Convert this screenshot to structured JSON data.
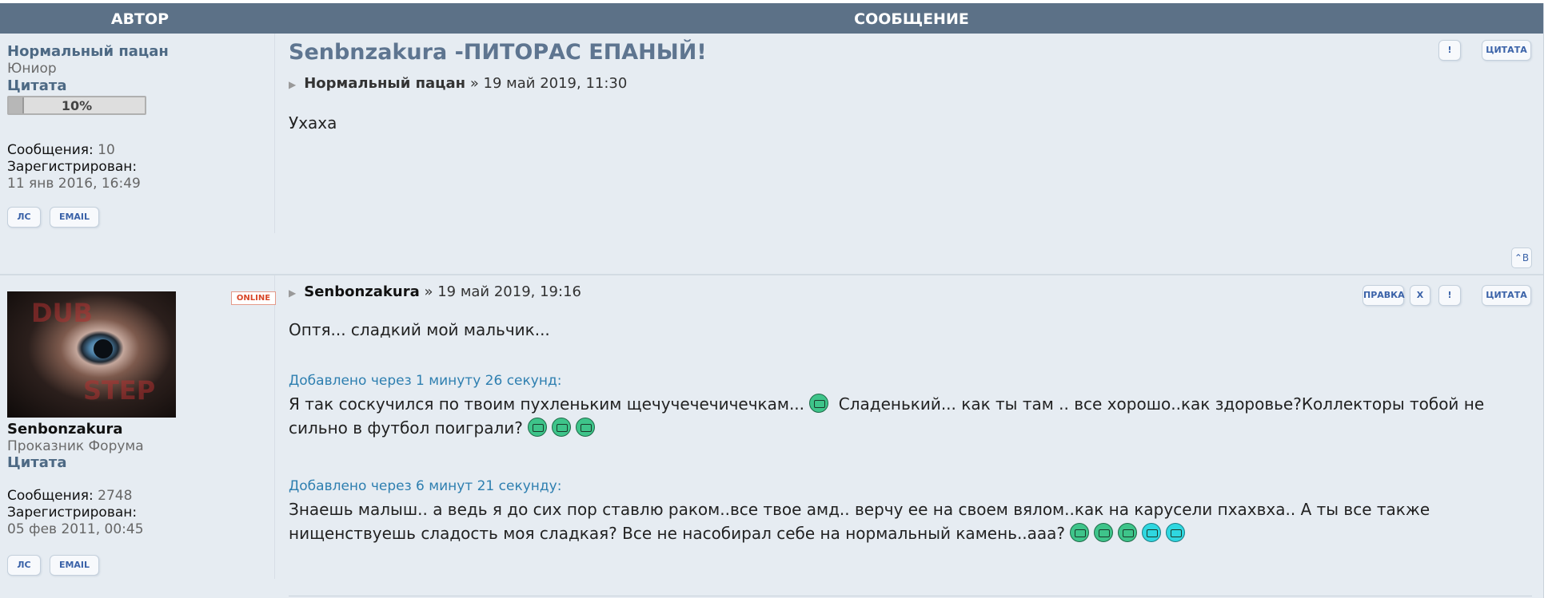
{
  "header": {
    "author_col": "АВТОР",
    "message_col": "СООБЩЕНИЕ"
  },
  "post1": {
    "author": "Нормальный пацан",
    "rank": "Юниор",
    "cite": "Цитата",
    "progress_text": "10%",
    "progress_value": 0.1,
    "messages_label": "Сообщения:",
    "messages_value": "10",
    "registered_label": "Зарегистрирован:",
    "registered_value": "11 янв 2016, 16:49",
    "pm_label": "ЛС",
    "email_label": "EMAIL",
    "title": "Senbnzakura -ПИТОРАС ЕПАНЫЙ!",
    "meta_author": "Нормальный пацан",
    "meta_date": "» 19 май 2019, 11:30",
    "body": "Ухаха",
    "report_label": "!",
    "quote_label": "ЦИТАТА",
    "top_label": "⌃B"
  },
  "post2": {
    "online_label": "ONLINE",
    "author": "Senbonzakura",
    "rank": "Проказник Форума",
    "cite": "Цитата",
    "messages_label": "Сообщения:",
    "messages_value": "2748",
    "registered_label": "Зарегистрирован:",
    "registered_value": "05 фев 2011, 00:45",
    "pm_label": "ЛС",
    "email_label": "EMAIL",
    "meta_author": "Senbonzakura",
    "meta_date": "» 19 май 2019, 19:16",
    "edit_label": "ПРАВКА",
    "delete_label": "X",
    "report_label": "!",
    "quote_label": "ЦИТАТА",
    "body1": "Оптя... сладкий мой мальчик...",
    "added1": "Добавлено через 1 минуту 26 секунд:",
    "body2a": "Я так соскучился по твоим пухленьким щечучечечичечкам...",
    "body2b": "Сладенький... как ты там .. все хорошо..как здоровье?Коллекторы тобой не сильно в футбол поиграли?",
    "added2": "Добавлено через 6 минут 21 секунду:",
    "body3": "Знаешь малыш.. а ведь я до сих пор ставлю раком..все твое амд.. верчу ее на своем вялом..как на карусели пхахвха.. А ты все также нищенствуешь сладость моя сладкая? Все не насобирал себе на нормальный камень..ааа?",
    "avatar_text1": "DUB",
    "avatar_text2": "STEP"
  }
}
